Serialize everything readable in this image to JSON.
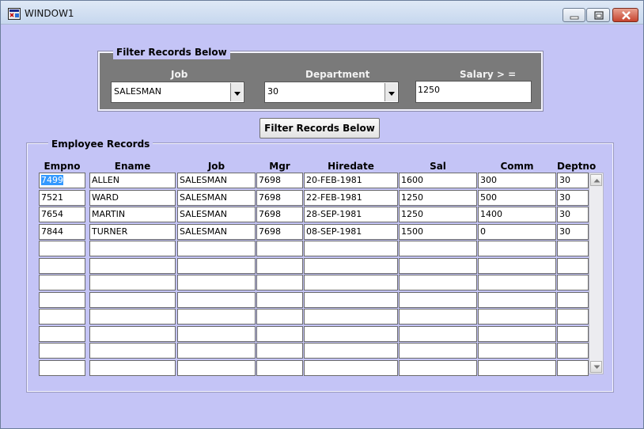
{
  "window": {
    "title": "WINDOW1"
  },
  "filter": {
    "legend": "Filter Records Below",
    "job_label": "Job",
    "job_value": "SALESMAN",
    "department_label": "Department",
    "department_value": "30",
    "salary_label": "Salary > =",
    "salary_value": "1250",
    "button_label": "Filter Records Below"
  },
  "records": {
    "legend": "Employee Records",
    "columns": [
      "Empno",
      "Ename",
      "Job",
      "Mgr",
      "Hiredate",
      "Sal",
      "Comm",
      "Deptno"
    ],
    "rows": [
      [
        "7499",
        "ALLEN",
        "SALESMAN",
        "7698",
        "20-FEB-1981",
        "1600",
        "300",
        "30"
      ],
      [
        "7521",
        "WARD",
        "SALESMAN",
        "7698",
        "22-FEB-1981",
        "1250",
        "500",
        "30"
      ],
      [
        "7654",
        "MARTIN",
        "SALESMAN",
        "7698",
        "28-SEP-1981",
        "1250",
        "1400",
        "30"
      ],
      [
        "7844",
        "TURNER",
        "SALESMAN",
        "7698",
        "08-SEP-1981",
        "1500",
        "0",
        "30"
      ]
    ],
    "visible_row_count": 12
  },
  "colors": {
    "canvas": "#c4c4f6",
    "filter_panel": "#7a7a7a",
    "selection": "#3399ff"
  }
}
